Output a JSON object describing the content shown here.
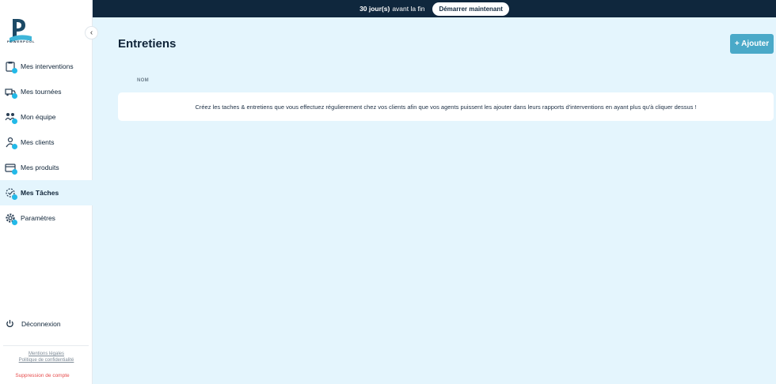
{
  "brand": {
    "name": "POWERPOOL"
  },
  "topbar": {
    "days": "30 jour(s)",
    "rest": "avant la fin",
    "cta": "Démarrer maintenant"
  },
  "sidebar": {
    "items": [
      {
        "label": "Mes interventions",
        "icon": "clipboard-icon",
        "active": false
      },
      {
        "label": "Mes tournées",
        "icon": "truck-icon",
        "active": false
      },
      {
        "label": "Mon équipe",
        "icon": "team-icon",
        "active": false
      },
      {
        "label": "Mes clients",
        "icon": "clients-icon",
        "active": false
      },
      {
        "label": "Mes produits",
        "icon": "products-icon",
        "active": false
      },
      {
        "label": "Mes Tâches",
        "icon": "tasks-icon",
        "active": true
      },
      {
        "label": "Paramètres",
        "icon": "gear-icon",
        "active": false
      }
    ],
    "logout": "Déconnexion",
    "legal1": "Mentions légales",
    "legal2": "Politique de confidentialité",
    "delete": "Suppression de compte"
  },
  "main": {
    "title": "Entretiens",
    "add_label": "+ Ajouter",
    "column": "NOM",
    "empty_text": "Créez les taches & entretiens que vous effectuez régulierement chez vos clients afin que vos agents puissent les ajouter dans leurs rapports d'interventions en ayant plus qu'à cliquer dessus !"
  },
  "colors": {
    "accent": "#23b9e8",
    "topbar": "#0f273d",
    "background": "#e4f5fd",
    "button": "#4aa9c8",
    "danger": "#e74b4b"
  }
}
